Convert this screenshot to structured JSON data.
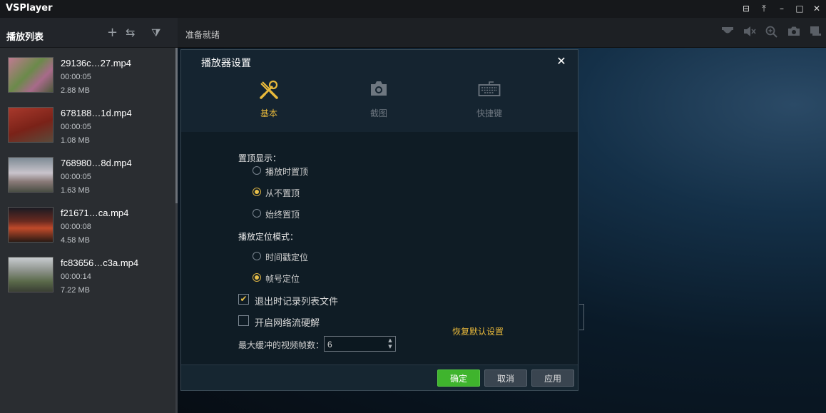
{
  "window": {
    "title": "VSPlayer",
    "controls": {
      "menu": "⊟",
      "pin": "⤒",
      "minimize": "–",
      "maximize": "□",
      "close": "✕"
    }
  },
  "sidebar": {
    "title": "播放列表",
    "icons": {
      "add": "+",
      "switch": "⇆",
      "filter": "⧩"
    },
    "items": [
      {
        "name": "29136c…27.mp4",
        "duration": "00:00:05",
        "size": "2.88 MB",
        "thumb_color": "#8a5a6a"
      },
      {
        "name": "678188…1d.mp4",
        "duration": "00:00:05",
        "size": "1.08 MB",
        "thumb_color": "#8c2b22"
      },
      {
        "name": "768980…8d.mp4",
        "duration": "00:00:05",
        "size": "1.63 MB",
        "thumb_color": "#9aa0a8"
      },
      {
        "name": "f21671…ca.mp4",
        "duration": "00:00:08",
        "size": "4.58 MB",
        "thumb_color": "#5a2a20"
      },
      {
        "name": "fc83656…c3a.mp4",
        "duration": "00:00:14",
        "size": "7.22 MB",
        "thumb_color": "#6a7260"
      }
    ]
  },
  "main": {
    "status": "准备就绪",
    "toolbar_icons": [
      "camera-dome-icon",
      "unmute-icon",
      "zoom-icon",
      "snapshot-icon",
      "record-icon"
    ]
  },
  "dialog": {
    "title": "播放器设置",
    "close": "✕",
    "tabs": [
      {
        "label": "基本",
        "icon": "🔧",
        "active": true
      },
      {
        "label": "截图",
        "icon": "📷",
        "active": false
      },
      {
        "label": "快捷键",
        "icon": "⌨",
        "active": false
      }
    ],
    "topmost": {
      "label": "置顶显示：",
      "options": [
        {
          "label": "播放时置顶",
          "selected": false
        },
        {
          "label": "从不置顶",
          "selected": true
        },
        {
          "label": "始终置顶",
          "selected": false
        }
      ]
    },
    "seek_mode": {
      "label": "播放定位模式：",
      "options": [
        {
          "label": "时间戳定位",
          "selected": false
        },
        {
          "label": "帧号定位",
          "selected": true
        }
      ]
    },
    "checkboxes": [
      {
        "label": "退出时记录列表文件",
        "checked": true,
        "mark": "✔"
      },
      {
        "label": "开启网络流硬解",
        "checked": false,
        "mark": ""
      }
    ],
    "restore_defaults": "恢复默认设置",
    "cache": {
      "label": "最大缓冲的视频帧数：",
      "value": "6"
    },
    "buttons": {
      "ok": "确定",
      "cancel": "取消",
      "apply": "应用"
    }
  }
}
